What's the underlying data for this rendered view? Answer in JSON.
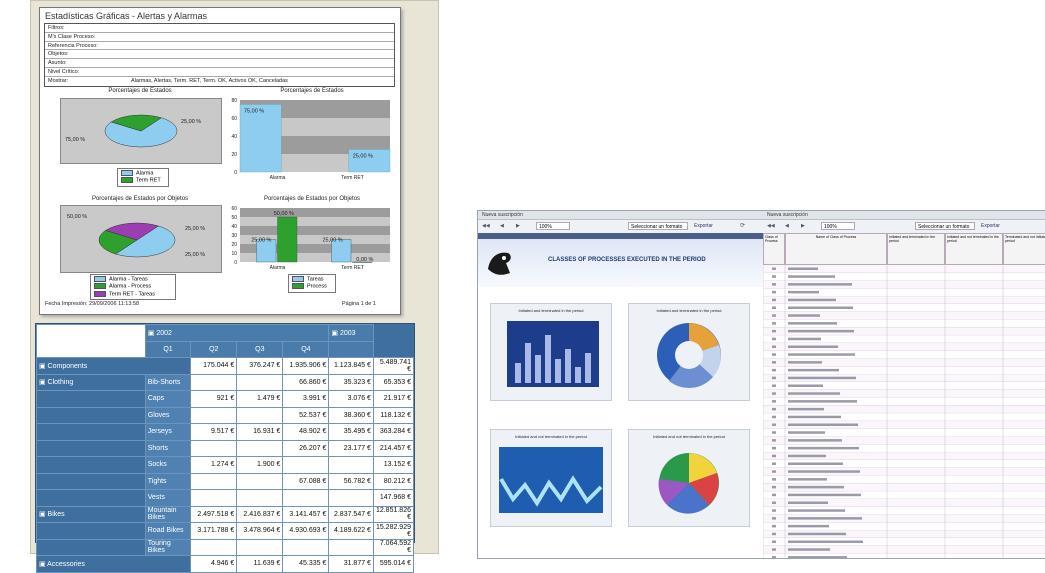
{
  "report": {
    "title": "Estadísticas Gráficas - Alertas y Alarmas",
    "filters": [
      {
        "label": "Filtros:",
        "value": ""
      },
      {
        "label": "M's Clase Proceso:",
        "value": ""
      },
      {
        "label": "Referencia Proceso:",
        "value": ""
      },
      {
        "label": "Objetos:",
        "value": ""
      },
      {
        "label": "Asunto:",
        "value": ""
      },
      {
        "label": "Nivel Crítico:",
        "value": ""
      },
      {
        "label": "Mostrar:",
        "value": "Alarmas, Alertas, Term. RET, Term. OK, Activos OK, Canceladas"
      }
    ],
    "footer_left": "Fecha Impresión: 29/09/2006 11:13:58",
    "footer_right": "Página 1 de 1"
  },
  "chart_data": [
    {
      "type": "pie",
      "title": "Porcentajes de Estados",
      "categories": [
        "Alarma",
        "Term RET"
      ],
      "values": [
        75,
        25
      ],
      "labels": [
        "75,00 %",
        "25,00 %"
      ],
      "colors": [
        "#8ecdf0",
        "#2ea02e"
      ]
    },
    {
      "type": "bar",
      "title": "Porcentajes de Estados",
      "categories": [
        "Alarma",
        "Term RET"
      ],
      "values": [
        75,
        25
      ],
      "labels": [
        "75,00 %",
        "25,00 %"
      ],
      "yticks": [
        "0",
        "20",
        "40",
        "60",
        "80"
      ],
      "ylim": [
        0,
        80
      ],
      "color": "#8ecdf0"
    },
    {
      "type": "pie",
      "title": "Porcentajes de Estados por Objetos",
      "categories": [
        "Alarma - Tareas",
        "Alarma - Process",
        "Term RET - Tareas"
      ],
      "values": [
        50,
        25,
        25
      ],
      "labels": [
        "50,00 %",
        "25,00 %",
        "25,00 %"
      ],
      "colors": [
        "#8ecdf0",
        "#2ea02e",
        "#9b3fb0"
      ]
    },
    {
      "type": "bar",
      "title": "Porcentajes de Estados por Objetos",
      "categories": [
        "Alarma",
        "Term RET"
      ],
      "series": [
        {
          "name": "Tareas",
          "values": [
            25,
            25
          ],
          "labels": [
            "25,00 %",
            "25,00 %"
          ]
        },
        {
          "name": "Process",
          "values": [
            50,
            0
          ],
          "labels": [
            "50,00 %",
            "0,00 %"
          ]
        }
      ],
      "yticks": [
        "0",
        "10",
        "20",
        "30",
        "40",
        "50",
        "60"
      ],
      "ylim": [
        0,
        60
      ],
      "colors": [
        "#8ecdf0",
        "#2ea02e"
      ]
    }
  ],
  "pivot": {
    "year_a": "2002",
    "year_b": "2003",
    "quarters": [
      "Q1",
      "Q2",
      "Q3",
      "Q4"
    ],
    "rows": [
      {
        "cat": "Components",
        "sub": "",
        "cells": [
          "175.044 €",
          "376.247 €",
          "1.935.906 €",
          "1.123.845 €",
          "5.489.741 €"
        ],
        "cat_row": true
      },
      {
        "cat": "Clothing",
        "sub": "Bib-Shorts",
        "cells": [
          "",
          "",
          "66.860 €",
          "35.323 €",
          "65.353 €"
        ],
        "cat_row": true
      },
      {
        "cat": "",
        "sub": "Caps",
        "cells": [
          "921 €",
          "1.479 €",
          "3.991 €",
          "3.076 €",
          "21.917 €"
        ]
      },
      {
        "cat": "",
        "sub": "Gloves",
        "cells": [
          "",
          "",
          "52.537 €",
          "38.360 €",
          "118.132 €"
        ]
      },
      {
        "cat": "",
        "sub": "Jerseys",
        "cells": [
          "9.517 €",
          "16.931 €",
          "48.902 €",
          "35.495 €",
          "363.284 €"
        ]
      },
      {
        "cat": "",
        "sub": "Shorts",
        "cells": [
          "",
          "",
          "26.207 €",
          "23.177 €",
          "214.457 €"
        ]
      },
      {
        "cat": "",
        "sub": "Socks",
        "cells": [
          "1.274 €",
          "1.900 €",
          "",
          "",
          "13.152 €"
        ]
      },
      {
        "cat": "",
        "sub": "Tights",
        "cells": [
          "",
          "",
          "67.088 €",
          "56.782 €",
          "80.212 €"
        ]
      },
      {
        "cat": "",
        "sub": "Vests",
        "cells": [
          "",
          "",
          "",
          "",
          "147.968 €"
        ]
      },
      {
        "cat": "Bikes",
        "sub": "Mountain Bikes",
        "cells": [
          "2.497.518 €",
          "2.416.837 €",
          "3.141.457 €",
          "2.837.547 €",
          "12.851.826 €"
        ],
        "cat_row": true
      },
      {
        "cat": "",
        "sub": "Road Bikes",
        "cells": [
          "3.171.788 €",
          "3.478.964 €",
          "4.930.693 €",
          "4.189.622 €",
          "15.282.929 €"
        ]
      },
      {
        "cat": "",
        "sub": "Touring Bikes",
        "cells": [
          "",
          "",
          "",
          "",
          "7.064.592 €"
        ]
      },
      {
        "cat": "Accessories",
        "sub": "",
        "cells": [
          "4.946 €",
          "11.639 €",
          "45.335 €",
          "31.877 €",
          "595.014 €"
        ],
        "cat_row": true
      }
    ]
  },
  "right": {
    "window_title_left": "Nueva suscripción",
    "window_title_right": "Nueva suscripción",
    "zoom_left": "100%",
    "zoom_right": "100%",
    "export_placeholder": "Seleccionar un formato",
    "export_link": "Exportar",
    "report_title": "CLASSES OF PROCESSES EXECUTED IN THE PERIOD",
    "chart_titles": [
      "Initiated and terminated in the period",
      "Initiated and terminated in the period",
      "Initiated and not terminated in the period",
      "Initiated and not terminated in the period"
    ],
    "table_headers": [
      "Class of Process",
      "Name of Class of Process",
      "Initiated and terminated in the period",
      "Initiated and not terminated in the period",
      "Terminated and not initiated in the period"
    ]
  }
}
